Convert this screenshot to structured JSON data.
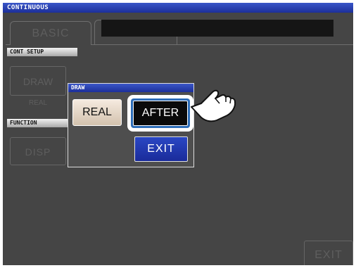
{
  "window": {
    "title": "CONTINUOUS"
  },
  "tabs": [
    {
      "label": "BASIC",
      "state": "inactive"
    }
  ],
  "sections": {
    "cont_setup": "CONT SETUP",
    "function": "FUNCTION"
  },
  "background_buttons": {
    "draw": "DRAW",
    "draw_value": "REAL",
    "disp": "DISP",
    "exit": "EXIT"
  },
  "dialog": {
    "title": "DRAW",
    "options": [
      {
        "label": "REAL",
        "selected": false
      },
      {
        "label": "AFTER",
        "selected": true
      }
    ],
    "exit_label": "EXIT"
  },
  "pointer_icon": "pointing-hand-icon",
  "colors": {
    "title_bar": "#2a44b8",
    "screen_background": "#454545",
    "highlight_ring": "#2d6db8",
    "exit_button": "#2239b0",
    "real_button": "#e8dccb",
    "selected_button": "#0a0a0a"
  }
}
